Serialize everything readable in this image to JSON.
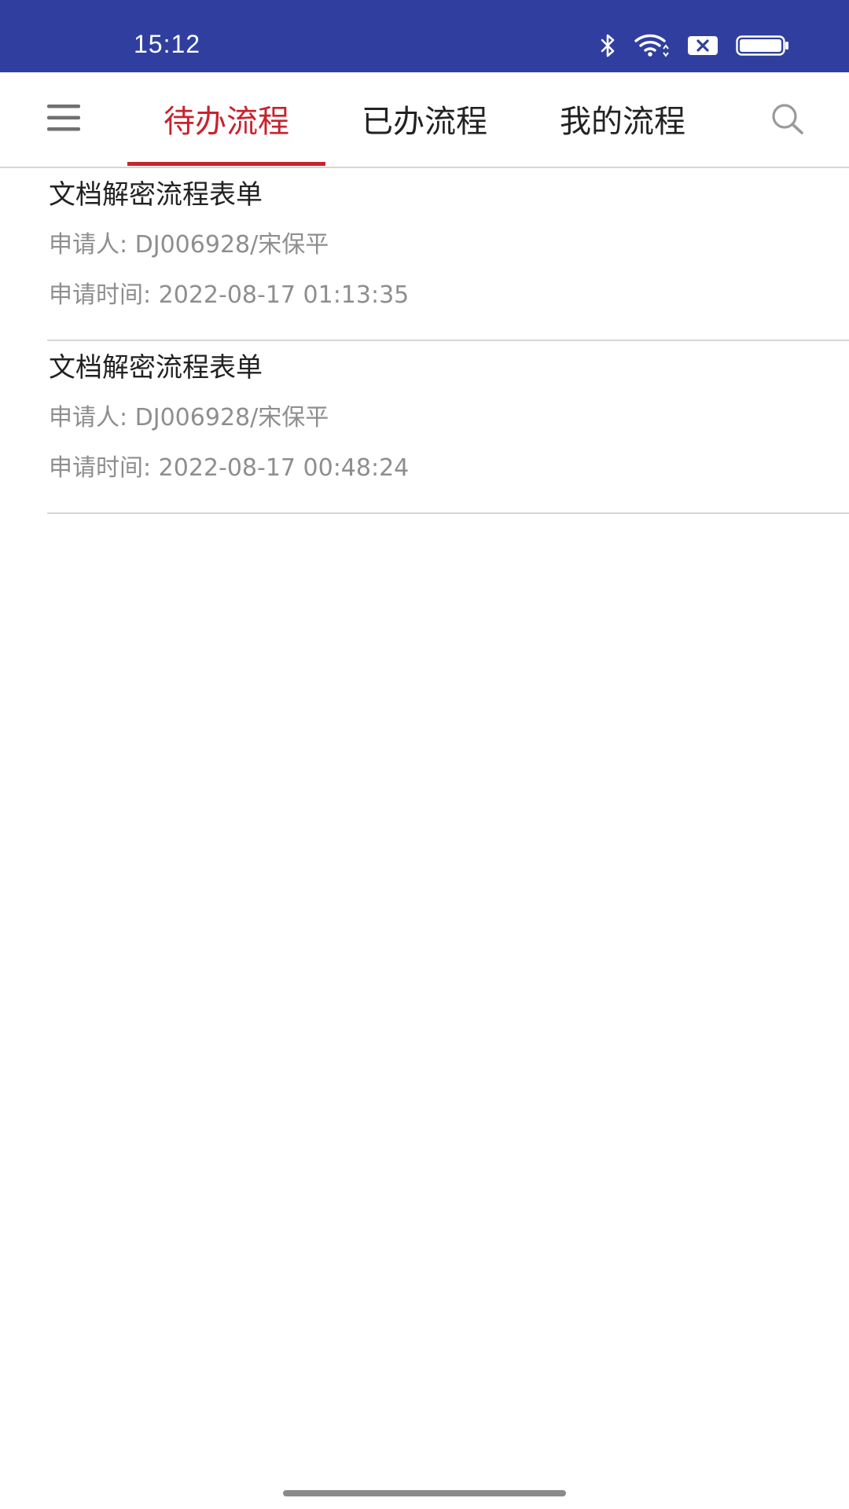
{
  "status_bar": {
    "time": "15:12",
    "icons": [
      "bluetooth-icon",
      "wifi-icon",
      "no-sim-icon",
      "battery-icon"
    ],
    "background": "#303f9f"
  },
  "header": {
    "menu_icon": "hamburger-menu-icon",
    "tabs": [
      {
        "label": "待办流程",
        "active": true
      },
      {
        "label": "已办流程",
        "active": false
      },
      {
        "label": "我的流程",
        "active": false
      }
    ],
    "search_icon": "search-icon",
    "accent_color": "#c8232d"
  },
  "list": {
    "items": [
      {
        "title": "文档解密流程表单",
        "applicant": "申请人: DJ006928/宋保平",
        "time": "申请时间: 2022-08-17 01:13:35"
      },
      {
        "title": "文档解密流程表单",
        "applicant": "申请人: DJ006928/宋保平",
        "time": "申请时间: 2022-08-17 00:48:24"
      }
    ]
  }
}
